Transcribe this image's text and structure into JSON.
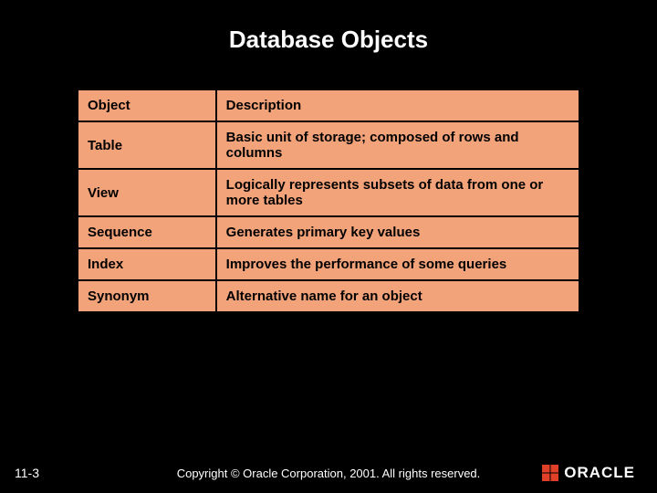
{
  "title": "Database Objects",
  "table": {
    "headers": {
      "object": "Object",
      "description": "Description"
    },
    "rows": [
      {
        "object": "Table",
        "description": "Basic unit of storage; composed of rows and columns"
      },
      {
        "object": "View",
        "description": "Logically represents subsets of data from one or more tables"
      },
      {
        "object": "Sequence",
        "description": "Generates primary key values"
      },
      {
        "object": "Index",
        "description": "Improves the performance of some queries"
      },
      {
        "object": "Synonym",
        "description": "Alternative name for an object"
      }
    ]
  },
  "footer": {
    "page": "11-3",
    "copyright": "Copyright © Oracle Corporation, 2001. All rights reserved.",
    "logo_text": "ORACLE"
  }
}
